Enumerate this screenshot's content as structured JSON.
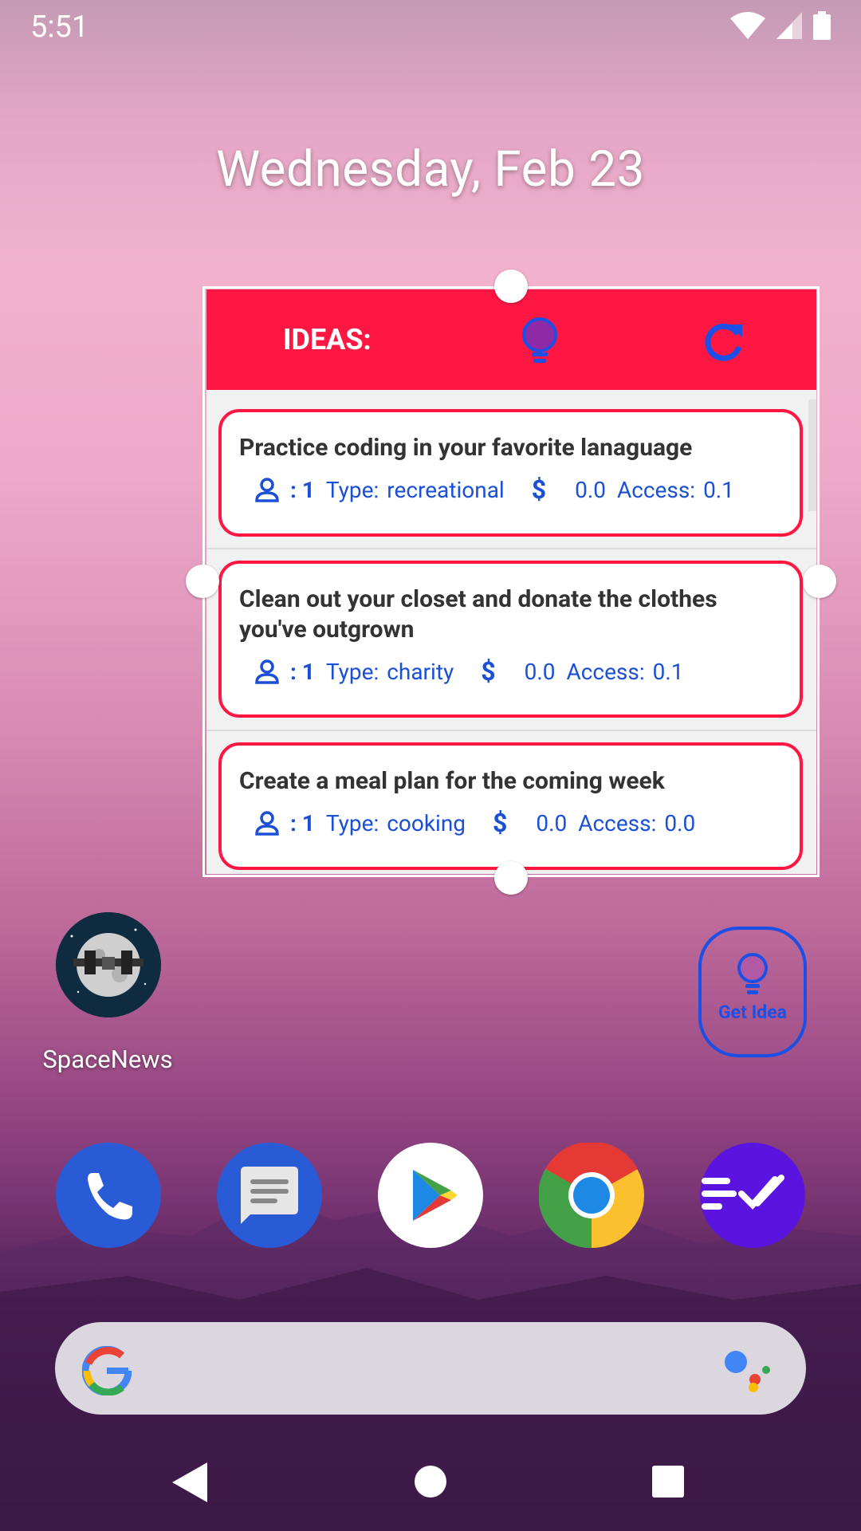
{
  "status_bar": {
    "time": "5:51"
  },
  "home": {
    "date": "Wednesday, Feb 23"
  },
  "ideas_widget": {
    "title": "IDEAS:",
    "cards": [
      {
        "title": "Practice coding in your favorite lanaguage",
        "participants": ": 1",
        "type_label": "Type:",
        "type": "recreational",
        "price": "0.0",
        "access_label": "Access:",
        "access": "0.1"
      },
      {
        "title": "Clean out your closet and donate the clothes you've outgrown",
        "participants": ": 1",
        "type_label": "Type:",
        "type": "charity",
        "price": "0.0",
        "access_label": "Access:",
        "access": "0.1"
      },
      {
        "title": "Create a meal plan for the coming week",
        "participants": ": 1",
        "type_label": "Type:",
        "type": "cooking",
        "price": "0.0",
        "access_label": "Access:",
        "access": "0.0"
      }
    ],
    "dollar_symbol": "$"
  },
  "apps": {
    "spacenews_label": "SpaceNews"
  },
  "get_idea_widget": {
    "label": "Get Idea"
  },
  "colors": {
    "accent_red": "#ff1744",
    "accent_blue": "#1a4fd6"
  },
  "icons": {
    "widget_header": [
      "lightbulb-icon",
      "refresh-icon"
    ],
    "card_meta": [
      "person-icon",
      "dollar-icon"
    ],
    "dock": [
      "phone-icon",
      "messages-icon",
      "play-store-icon",
      "chrome-icon",
      "tasks-icon"
    ],
    "nav": [
      "back-icon",
      "home-icon",
      "recents-icon"
    ]
  }
}
